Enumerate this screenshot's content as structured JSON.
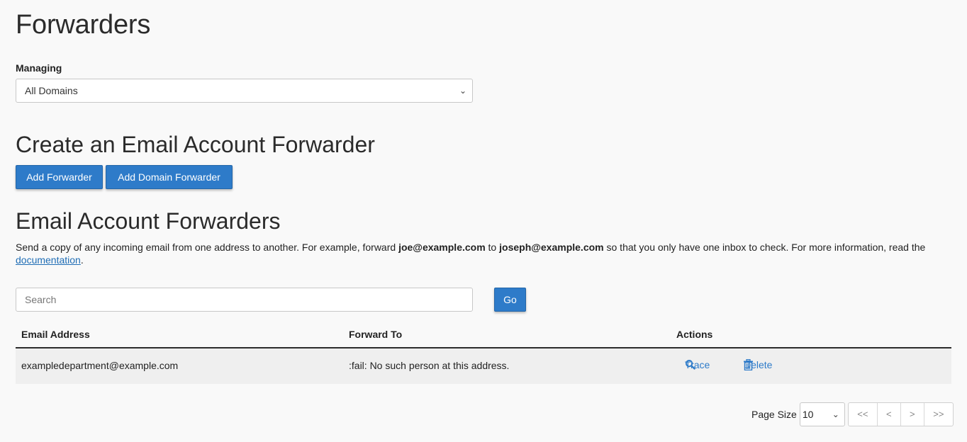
{
  "page": {
    "title": "Forwarders"
  },
  "managing": {
    "label": "Managing",
    "selected": "All Domains",
    "chevron_icon": "chevron-down-icon"
  },
  "create_section": {
    "heading": "Create an Email Account Forwarder",
    "add_forwarder_label": "Add Forwarder",
    "add_domain_forwarder_label": "Add Domain Forwarder"
  },
  "list_section": {
    "heading": "Email Account Forwarders",
    "description": {
      "part1": "Send a copy of any incoming email from one address to another. For example, forward ",
      "bold1": "joe@example.com",
      "part2": " to ",
      "bold2": "joseph@example.com",
      "part3": " so that you only have one inbox to check. For more information, read the ",
      "link": "documentation",
      "part4": "."
    },
    "search": {
      "placeholder": "Search",
      "value": "",
      "go_label": "Go"
    }
  },
  "table": {
    "columns": [
      "Email Address",
      "Forward To",
      "Actions"
    ],
    "rows": [
      {
        "email": "exampledepartment@example.com",
        "forward_to": ":fail: No such person at this address.",
        "actions": {
          "trace_label": "Trace",
          "trace_icon": "search-icon",
          "delete_label": "Delete",
          "delete_icon": "trash-icon"
        }
      }
    ]
  },
  "pagination": {
    "page_size_label": "Page Size",
    "page_size": "10",
    "first": "<<",
    "prev": "<",
    "next": ">",
    "last": ">>"
  },
  "colors": {
    "primary_button": "#2e7bc9",
    "link": "#1f6db5",
    "background": "#f9f9f9",
    "row_background": "#efefef"
  }
}
